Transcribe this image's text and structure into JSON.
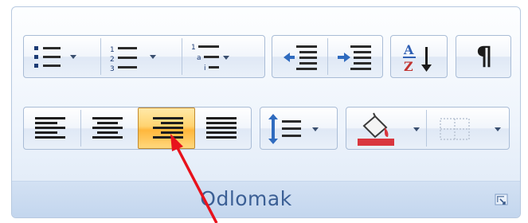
{
  "ribbon_group": {
    "caption": "Odlomak",
    "dialog_launcher_icon": "dialog-launcher-icon"
  },
  "row1": [
    {
      "name": "bullets",
      "icon": "bullets-icon",
      "has_dropdown": true
    },
    {
      "name": "numbering",
      "icon": "numbering-icon",
      "has_dropdown": true
    },
    {
      "name": "multilevel-list",
      "icon": "multilevel-list-icon",
      "has_dropdown": true
    },
    {
      "name": "decrease-indent",
      "icon": "decrease-indent-icon",
      "has_dropdown": false
    },
    {
      "name": "increase-indent",
      "icon": "increase-indent-icon",
      "has_dropdown": false
    },
    {
      "name": "sort",
      "icon": "sort-az-icon",
      "label_top": "A",
      "label_bottom": "Z"
    },
    {
      "name": "show-hide",
      "icon": "pilcrow-icon",
      "label": "¶"
    }
  ],
  "row2": [
    {
      "name": "align-left",
      "icon": "align-left-icon",
      "selected": false
    },
    {
      "name": "center",
      "icon": "align-center-icon",
      "selected": false
    },
    {
      "name": "align-right",
      "icon": "align-right-icon",
      "selected": true
    },
    {
      "name": "justify",
      "icon": "justify-icon",
      "selected": false
    },
    {
      "name": "line-spacing",
      "icon": "line-spacing-icon",
      "has_dropdown": true
    },
    {
      "name": "shading",
      "icon": "shading-paint-bucket-icon",
      "has_dropdown": true,
      "color": "#d9363e"
    },
    {
      "name": "borders",
      "icon": "borders-icon",
      "has_dropdown": true,
      "enabled": false
    }
  ],
  "annotation": {
    "icon": "red-arrow-pointer",
    "color": "#e8121c"
  }
}
